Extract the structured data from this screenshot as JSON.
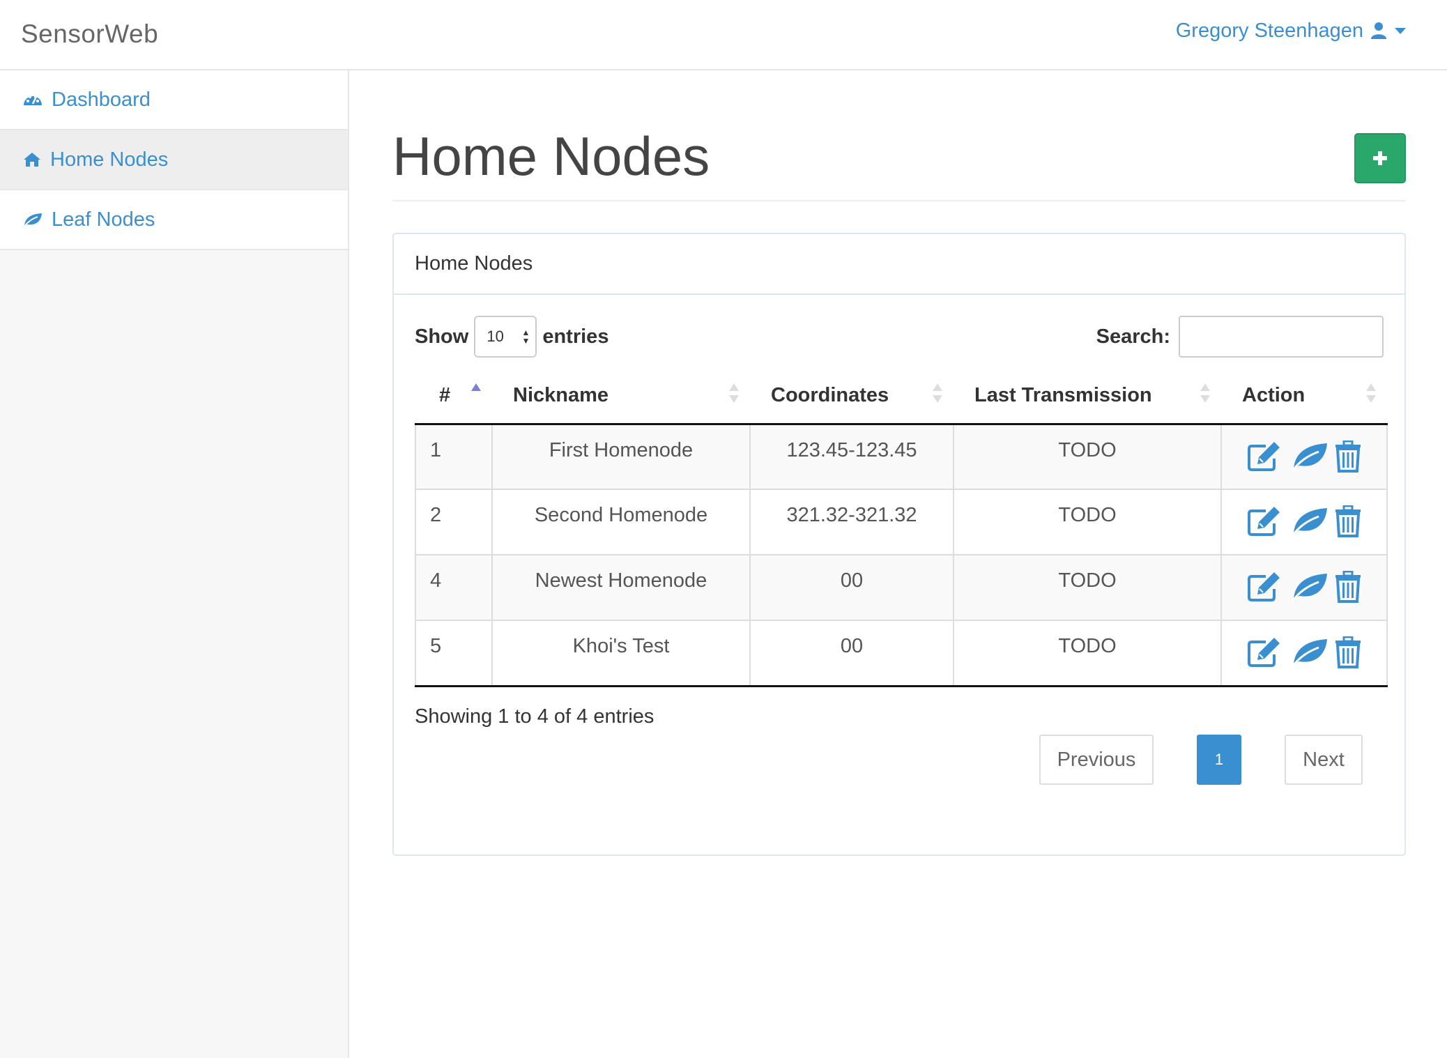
{
  "app": {
    "brand": "SensorWeb"
  },
  "user": {
    "name": "Gregory Steenhagen"
  },
  "sidebar": {
    "items": [
      {
        "label": "Dashboard",
        "icon": "dashboard-icon",
        "active": false
      },
      {
        "label": "Home Nodes",
        "icon": "home-icon",
        "active": true
      },
      {
        "label": "Leaf Nodes",
        "icon": "leaf-icon",
        "active": false
      }
    ]
  },
  "page": {
    "title": "Home Nodes",
    "add_icon": "plus-icon"
  },
  "panel": {
    "heading": "Home Nodes",
    "length": {
      "prefix": "Show",
      "value": "10",
      "suffix": "entries"
    },
    "search": {
      "label": "Search:",
      "value": "",
      "placeholder": ""
    },
    "columns": [
      "#",
      "Nickname",
      "Coordinates",
      "Last Transmission",
      "Action"
    ],
    "sorted_column": "#",
    "sort_direction": "ascending",
    "rows": [
      {
        "id": "1",
        "nickname": "First Homenode",
        "coordinates": "123.45-123.45",
        "last_transmission": "TODO"
      },
      {
        "id": "2",
        "nickname": "Second Homenode",
        "coordinates": "321.32-321.32",
        "last_transmission": "TODO"
      },
      {
        "id": "4",
        "nickname": "Newest Homenode",
        "coordinates": "00",
        "last_transmission": "TODO"
      },
      {
        "id": "5",
        "nickname": "Khoi's Test",
        "coordinates": "00",
        "last_transmission": "TODO"
      }
    ],
    "row_action_icons": [
      "edit-icon",
      "leaf-icon",
      "trash-icon"
    ],
    "info": "Showing 1 to 4 of 4 entries",
    "pagination": {
      "previous": "Previous",
      "current": "1",
      "next": "Next"
    }
  },
  "colors": {
    "accent": "#3a8fd0",
    "add_button": "#2aa76b",
    "sort_active": "#7b7fd6"
  }
}
